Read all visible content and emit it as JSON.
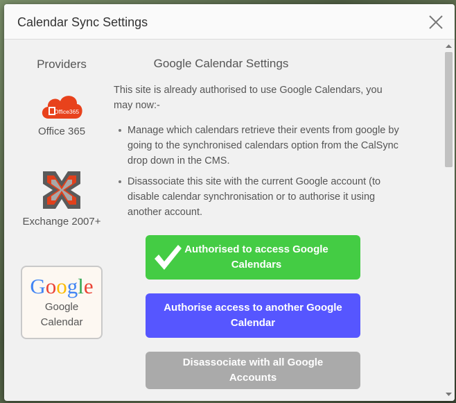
{
  "dialog": {
    "title": "Calendar Sync Settings"
  },
  "providers": {
    "heading": "Providers",
    "items": [
      {
        "label": "Office 365",
        "logo_text": "Office365",
        "icon": "office365-icon"
      },
      {
        "label": "Exchange 2007+",
        "icon": "exchange-icon"
      },
      {
        "label": "Google Calendar",
        "logo_text": "Google",
        "icon": "google-logo",
        "selected": true
      }
    ]
  },
  "settings": {
    "heading": "Google Calendar Settings",
    "intro": "This site is already authorised to use Google Calendars, you may now:-",
    "options": [
      "Manage which calendars retrieve their events from google by going to the synchronised calendars option from the CalSync drop down in the CMS.",
      "Disassociate this site with the current Google account (to disable calendar synchronisation or to authorise it using another account."
    ]
  },
  "actions": {
    "authorised_label": "Authorised to access Google Calendars",
    "authorise_another_label": "Authorise access to another Google Calendar",
    "disassociate_label": "Disassociate with all Google Accounts"
  },
  "colors": {
    "authorised": "#44cc44",
    "authorise_another": "#5656ff",
    "disassociate": "#aaaaaa",
    "office365": "#e8421c",
    "google_blue": "#4285f4",
    "google_red": "#ea4335",
    "google_yellow": "#fbbc05",
    "google_green": "#34a853"
  }
}
